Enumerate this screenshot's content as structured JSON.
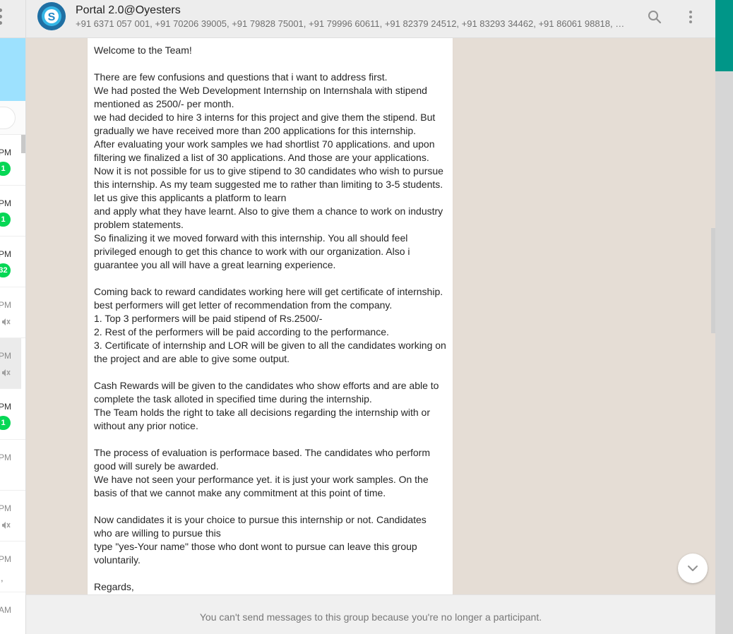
{
  "group": {
    "title": "Portal 2.0@Oyesters",
    "participants": "+91 6371 057 001, +91 70206 39005, +91 79828 75001, +91 79996 60611, +91 82379 24512, +91 83293 34462, +91 86061 98818, +91 9..."
  },
  "chat_list": [
    {
      "time": "PM",
      "badge": "1"
    },
    {
      "time": "PM",
      "badge": "1"
    },
    {
      "time": "PM",
      "badge": "32"
    },
    {
      "time": "PM",
      "muted": true
    },
    {
      "time": "PM",
      "muted": true
    },
    {
      "time": "PM",
      "badge": "1"
    },
    {
      "time": "PM"
    },
    {
      "time": "PM",
      "muted": true
    },
    {
      "time": "PM",
      "extra": ","
    },
    {
      "time": "AM"
    }
  ],
  "message": {
    "text": "Welcome to the Team!\n\nThere are few confusions and questions that i want to address first.\nWe had posted the Web Development Internship on Internshala with stipend mentioned as 2500/- per month.\nwe had decided to hire 3 interns for this project and give them the stipend. But gradually we have received more than 200 applications for this internship.\nAfter evaluating your work samples we had shortlist 70 applications. and upon filtering we finalized a list of 30 applications. And those are your applications.\nNow it is not possible for us to give stipend to 30 candidates who wish to pursue this internship. As my team suggested me to rather than limiting to 3-5 students. let us give this applicants a platform to learn\nand apply what they have learnt. Also to give them a chance to work on industry problem statements.\nSo finalizing it we moved forward with this internship. You all should feel privileged enough to get this chance to work with our organization. Also i guarantee you all will have a great learning experience.\n\nComing back to reward candidates working here will get certificate of internship. best performers will get letter of recommendation from the company.\n1. Top 3 performers will be paid stipend of Rs.2500/-\n2. Rest of the performers will be paid according to the performance.\n3. Certificate of internship and LOR will be given to all the candidates working on the project and are able to give some output.\n\nCash Rewards will be given to the candidates who show efforts and are able to complete the task alloted in specified time during the internship.\nThe Team holds the right to take all decisions regarding the internship with or without any prior notice.\n\nThe process of evaluation is performace based. The candidates who perform good will surely be awarded.\nWe have not seen your performance yet. it is just your work samples. On the basis of that we cannot make any commitment at this point of time.\n\nNow candidates it is your choice to pursue this internship or not. Candidates who are willing to pursue this\ntype \"yes-Your name\" those who dont wont to pursue can leave this group voluntarily.\n\nRegards,"
  },
  "footer": {
    "notice": "You can't send messages to this group because you're no longer a participant."
  },
  "icons": {
    "avatar_letter": "S",
    "search": "search-icon",
    "menu": "more-vert-icon",
    "scroll": "chevron-down-icon",
    "mute": "mute-icon"
  },
  "colors": {
    "badge": "#06d755",
    "accent": "#009688",
    "banner": "#9de1fe",
    "wallpaper": "#e5ddd5"
  }
}
